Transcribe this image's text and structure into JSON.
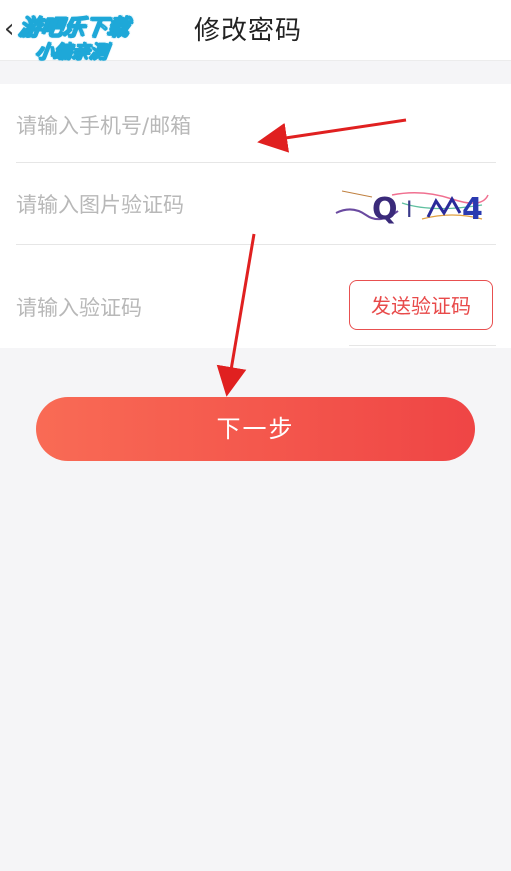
{
  "header": {
    "title": "修改密码",
    "watermark_line1": "游吧乐下载",
    "watermark_line2": "小编亲测"
  },
  "form": {
    "account_placeholder": "请输入手机号/邮箱",
    "captcha_placeholder": "请输入图片验证码",
    "captcha_text": "QM4",
    "code_placeholder": "请输入验证码",
    "send_code_label": "发送验证码"
  },
  "actions": {
    "next_label": "下一步"
  },
  "colors": {
    "accent": "#ef4545",
    "gradient_start": "#f96b55",
    "annotation": "#e02020"
  }
}
